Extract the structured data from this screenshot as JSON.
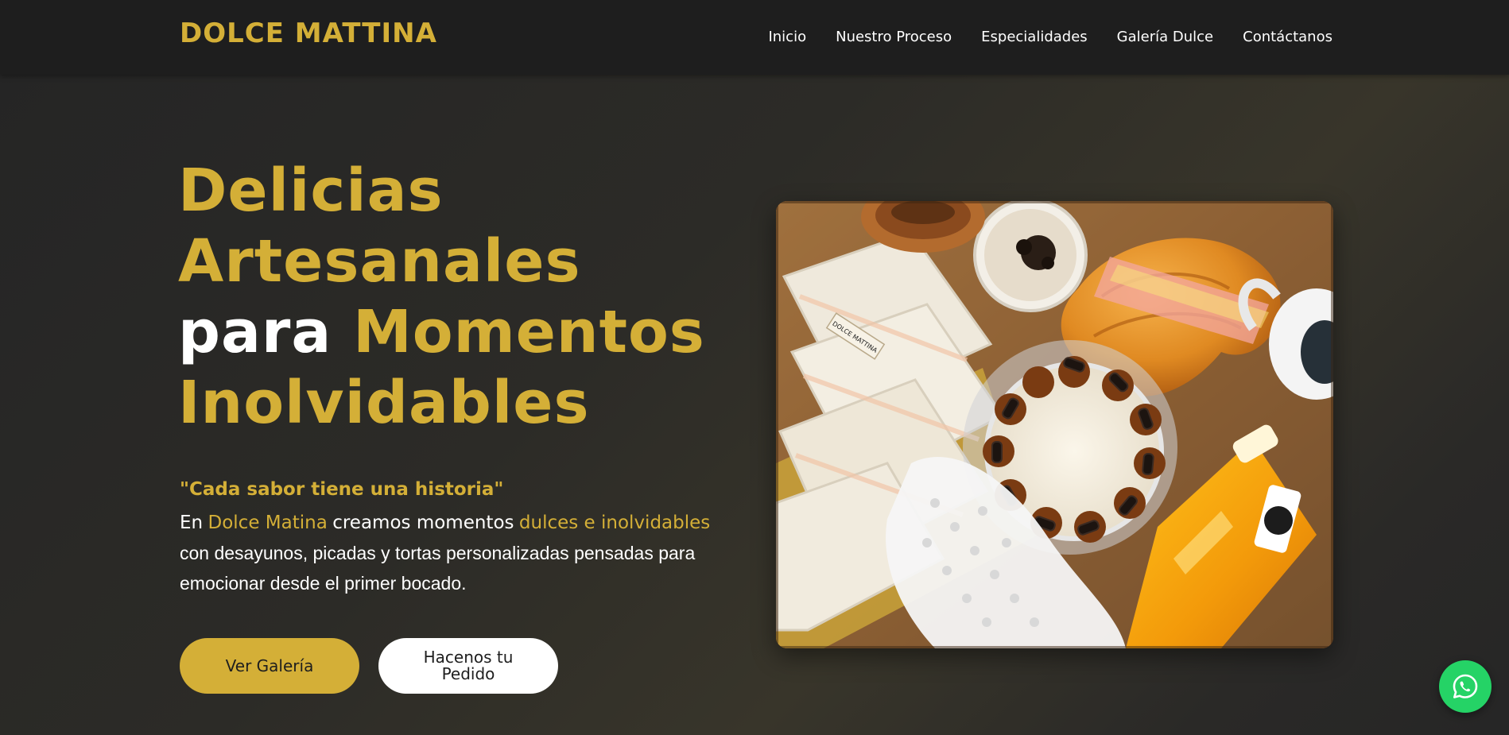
{
  "nav": {
    "brand": "DOLCE MATTINA",
    "links": [
      "Inicio",
      "Nuestro Proceso",
      "Especialidades",
      "Galería Dulce",
      "Contáctanos"
    ]
  },
  "hero": {
    "headline": {
      "line1": "Delicias",
      "line2": "Artesanales",
      "line3_white": "para",
      "line3_gold": "Momentos",
      "line4": "Inolvidables"
    },
    "quote": "\"Cada sabor tiene una historia\"",
    "description": {
      "part1": "En",
      "brand": "Dolce Matina",
      "part2": "creamos momentos",
      "highlight": "dulces e inolvidables",
      "part3": "con desayunos, picadas y tortas personalizadas pensadas para emocionar desde el primer bocado."
    },
    "buttons": {
      "gallery": "Ver Galería",
      "order_line1": "Hacenos tu",
      "order_line2": "Pedido"
    },
    "image_label": "DOLCE MATTINA"
  },
  "colors": {
    "gold": "#d4af37",
    "nav_bg": "#1e1e1e",
    "hero_bg": "#262626",
    "whatsapp": "#25d366"
  },
  "icons": {
    "floating": "whatsapp-icon"
  }
}
